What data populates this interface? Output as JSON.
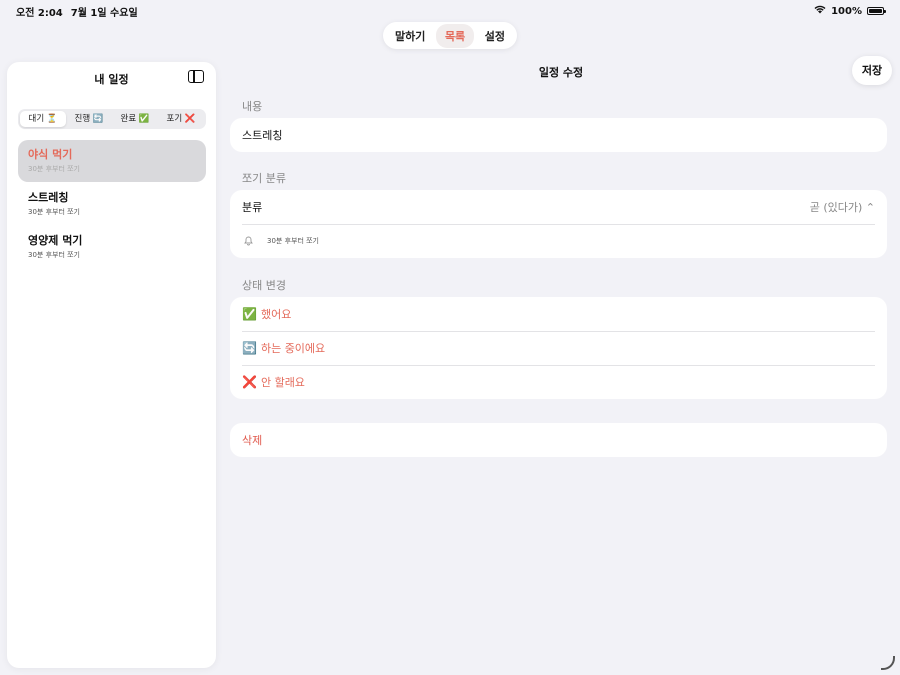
{
  "status_bar": {
    "time": "오전 2:04",
    "date": "7월 1일 수요일",
    "battery": "100%"
  },
  "top_tabs": [
    {
      "label": "말하기"
    },
    {
      "label": "목록",
      "active": true
    },
    {
      "label": "설정"
    }
  ],
  "sidebar": {
    "title": "내 일정",
    "filters": [
      "대기 ⏳",
      "진행 🔄",
      "완료 ✅",
      "포기 ❌"
    ],
    "items": [
      {
        "name": "야식 먹기",
        "sub": "30분 후부터 쪼기",
        "selected": true
      },
      {
        "name": "스트레칭",
        "sub": "30분 후부터 쪼기"
      },
      {
        "name": "영양제 먹기",
        "sub": "30분 후부터 쪼기"
      }
    ]
  },
  "main": {
    "title": "일정 수정",
    "save_label": "저장",
    "content_label": "내용",
    "content_value": "스트레칭",
    "category_section_label": "쪼기 분류",
    "category_label": "분류",
    "category_value": "곧 (있다가) ⌃",
    "reminder_text": "30분 후부터 쪼기",
    "status_section_label": "상태 변경",
    "status_options": [
      {
        "emoji": "✅",
        "label": "했어요"
      },
      {
        "emoji": "🔄",
        "label": "하는 중이에요"
      },
      {
        "emoji": "❌",
        "label": "안 할래요"
      }
    ],
    "delete_label": "삭제"
  },
  "colors": {
    "accent": "#e46a5a",
    "danger": "#e0584c",
    "background": "#f2f2f7"
  }
}
